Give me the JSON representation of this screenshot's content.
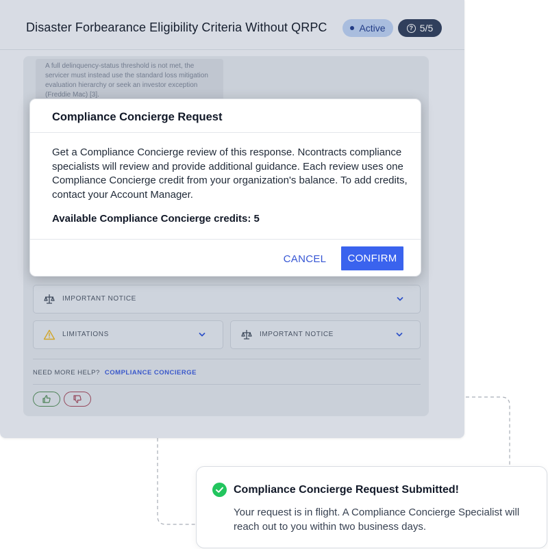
{
  "window": {
    "title": "Disaster Forbearance Eligibility Criteria Without QRPC",
    "status_badge": "Active",
    "count_badge": "5/5"
  },
  "background_card": {
    "faded_text": "A full delinquency-status threshold is not met, the servicer must instead use the standard loss mitigation evaluation hierarchy or seek an investor exception (Freddie Mac) [3].",
    "notices": [
      {
        "label": "IMPORTANT NOTICE",
        "icon": "scales-icon"
      },
      {
        "label": "LIMITATIONS",
        "icon": "warning-icon"
      },
      {
        "label": "IMPORTANT NOTICE",
        "icon": "scales-icon"
      }
    ],
    "help_question": "NEED MORE HELP?",
    "help_link": "COMPLIANCE CONCIERGE"
  },
  "modal": {
    "title": "Compliance Concierge Request",
    "body": "Get a Compliance Concierge review of this response. Ncontracts compliance specialists will review and provide additional guidance. Each review uses one Compliance Concierge credit from your organization's balance. To add credits, contact your Account Manager.",
    "credits_line": "Available Compliance Concierge credits: 5",
    "cancel_label": "CANCEL",
    "confirm_label": "CONFIRM"
  },
  "toast": {
    "title": "Compliance Concierge Request Submitted!",
    "body": "Your request is in flight. A Compliance Concierge Specialist will reach out to you within two business days."
  },
  "colors": {
    "accent": "#3a63ee",
    "success": "#22c55e",
    "warning": "#e6b325",
    "badge_active": "#b9cdf0",
    "badge_count": "#2f3e5c"
  }
}
